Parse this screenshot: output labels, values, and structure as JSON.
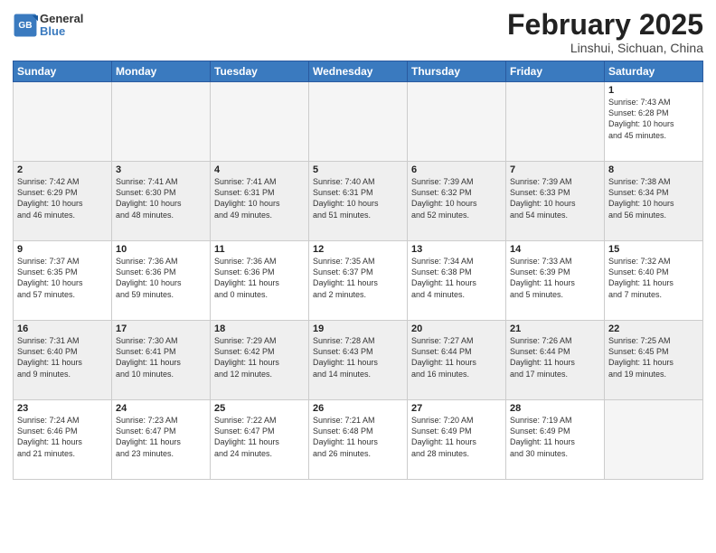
{
  "header": {
    "logo_line1": "General",
    "logo_line2": "Blue",
    "title": "February 2025",
    "subtitle": "Linshui, Sichuan, China"
  },
  "days_of_week": [
    "Sunday",
    "Monday",
    "Tuesday",
    "Wednesday",
    "Thursday",
    "Friday",
    "Saturday"
  ],
  "weeks": [
    [
      {
        "day": "",
        "info": ""
      },
      {
        "day": "",
        "info": ""
      },
      {
        "day": "",
        "info": ""
      },
      {
        "day": "",
        "info": ""
      },
      {
        "day": "",
        "info": ""
      },
      {
        "day": "",
        "info": ""
      },
      {
        "day": "1",
        "info": "Sunrise: 7:43 AM\nSunset: 6:28 PM\nDaylight: 10 hours\nand 45 minutes."
      }
    ],
    [
      {
        "day": "2",
        "info": "Sunrise: 7:42 AM\nSunset: 6:29 PM\nDaylight: 10 hours\nand 46 minutes."
      },
      {
        "day": "3",
        "info": "Sunrise: 7:41 AM\nSunset: 6:30 PM\nDaylight: 10 hours\nand 48 minutes."
      },
      {
        "day": "4",
        "info": "Sunrise: 7:41 AM\nSunset: 6:31 PM\nDaylight: 10 hours\nand 49 minutes."
      },
      {
        "day": "5",
        "info": "Sunrise: 7:40 AM\nSunset: 6:31 PM\nDaylight: 10 hours\nand 51 minutes."
      },
      {
        "day": "6",
        "info": "Sunrise: 7:39 AM\nSunset: 6:32 PM\nDaylight: 10 hours\nand 52 minutes."
      },
      {
        "day": "7",
        "info": "Sunrise: 7:39 AM\nSunset: 6:33 PM\nDaylight: 10 hours\nand 54 minutes."
      },
      {
        "day": "8",
        "info": "Sunrise: 7:38 AM\nSunset: 6:34 PM\nDaylight: 10 hours\nand 56 minutes."
      }
    ],
    [
      {
        "day": "9",
        "info": "Sunrise: 7:37 AM\nSunset: 6:35 PM\nDaylight: 10 hours\nand 57 minutes."
      },
      {
        "day": "10",
        "info": "Sunrise: 7:36 AM\nSunset: 6:36 PM\nDaylight: 10 hours\nand 59 minutes."
      },
      {
        "day": "11",
        "info": "Sunrise: 7:36 AM\nSunset: 6:36 PM\nDaylight: 11 hours\nand 0 minutes."
      },
      {
        "day": "12",
        "info": "Sunrise: 7:35 AM\nSunset: 6:37 PM\nDaylight: 11 hours\nand 2 minutes."
      },
      {
        "day": "13",
        "info": "Sunrise: 7:34 AM\nSunset: 6:38 PM\nDaylight: 11 hours\nand 4 minutes."
      },
      {
        "day": "14",
        "info": "Sunrise: 7:33 AM\nSunset: 6:39 PM\nDaylight: 11 hours\nand 5 minutes."
      },
      {
        "day": "15",
        "info": "Sunrise: 7:32 AM\nSunset: 6:40 PM\nDaylight: 11 hours\nand 7 minutes."
      }
    ],
    [
      {
        "day": "16",
        "info": "Sunrise: 7:31 AM\nSunset: 6:40 PM\nDaylight: 11 hours\nand 9 minutes."
      },
      {
        "day": "17",
        "info": "Sunrise: 7:30 AM\nSunset: 6:41 PM\nDaylight: 11 hours\nand 10 minutes."
      },
      {
        "day": "18",
        "info": "Sunrise: 7:29 AM\nSunset: 6:42 PM\nDaylight: 11 hours\nand 12 minutes."
      },
      {
        "day": "19",
        "info": "Sunrise: 7:28 AM\nSunset: 6:43 PM\nDaylight: 11 hours\nand 14 minutes."
      },
      {
        "day": "20",
        "info": "Sunrise: 7:27 AM\nSunset: 6:44 PM\nDaylight: 11 hours\nand 16 minutes."
      },
      {
        "day": "21",
        "info": "Sunrise: 7:26 AM\nSunset: 6:44 PM\nDaylight: 11 hours\nand 17 minutes."
      },
      {
        "day": "22",
        "info": "Sunrise: 7:25 AM\nSunset: 6:45 PM\nDaylight: 11 hours\nand 19 minutes."
      }
    ],
    [
      {
        "day": "23",
        "info": "Sunrise: 7:24 AM\nSunset: 6:46 PM\nDaylight: 11 hours\nand 21 minutes."
      },
      {
        "day": "24",
        "info": "Sunrise: 7:23 AM\nSunset: 6:47 PM\nDaylight: 11 hours\nand 23 minutes."
      },
      {
        "day": "25",
        "info": "Sunrise: 7:22 AM\nSunset: 6:47 PM\nDaylight: 11 hours\nand 24 minutes."
      },
      {
        "day": "26",
        "info": "Sunrise: 7:21 AM\nSunset: 6:48 PM\nDaylight: 11 hours\nand 26 minutes."
      },
      {
        "day": "27",
        "info": "Sunrise: 7:20 AM\nSunset: 6:49 PM\nDaylight: 11 hours\nand 28 minutes."
      },
      {
        "day": "28",
        "info": "Sunrise: 7:19 AM\nSunset: 6:49 PM\nDaylight: 11 hours\nand 30 minutes."
      },
      {
        "day": "",
        "info": ""
      }
    ]
  ]
}
